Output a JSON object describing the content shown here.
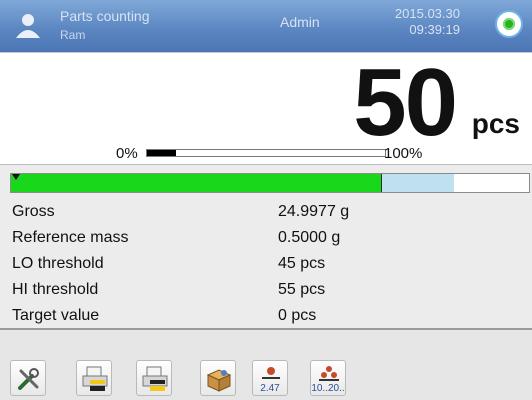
{
  "header": {
    "mode_title": "Parts counting",
    "user_label": "Ram",
    "center_label": "Admin",
    "date": "2015.03.30",
    "time": "09:39:19",
    "status_icon": "green-status-icon"
  },
  "reading": {
    "value": "50",
    "unit": "pcs",
    "progress_min_label": "0%",
    "progress_max_label": "100%",
    "progress_fraction": 0.12
  },
  "threshold_bar": {
    "ok_fraction": 0.715,
    "hi_start_fraction": 0.715,
    "hi_end_fraction": 0.855,
    "lo_marker_fraction": 0.715,
    "ok_color": "#19d81b",
    "hi_color": "#bfe0ef"
  },
  "info": [
    {
      "label": "Gross",
      "value": "24.9977 g"
    },
    {
      "label": "Reference mass",
      "value": "0.5000 g"
    },
    {
      "label": "LO threshold",
      "value": "45 pcs"
    },
    {
      "label": "HI threshold",
      "value": "55 pcs"
    },
    {
      "label": "Target value",
      "value": "0 pcs"
    }
  ],
  "toolbar": {
    "buttons": [
      {
        "name": "settings-tools-button",
        "icon": "tools-icon"
      },
      {
        "name": "printout-header-button",
        "icon": "print-yellow-icon"
      },
      {
        "name": "printout-footer-button",
        "icon": "print-yellow-bottom-icon"
      },
      {
        "name": "database-button",
        "icon": "box-icon"
      },
      {
        "name": "reference-mass-button",
        "icon": "weight-icon",
        "text": "2.47"
      },
      {
        "name": "set-quantity-button",
        "icon": "parts-icon",
        "text": "10..20.."
      }
    ]
  }
}
